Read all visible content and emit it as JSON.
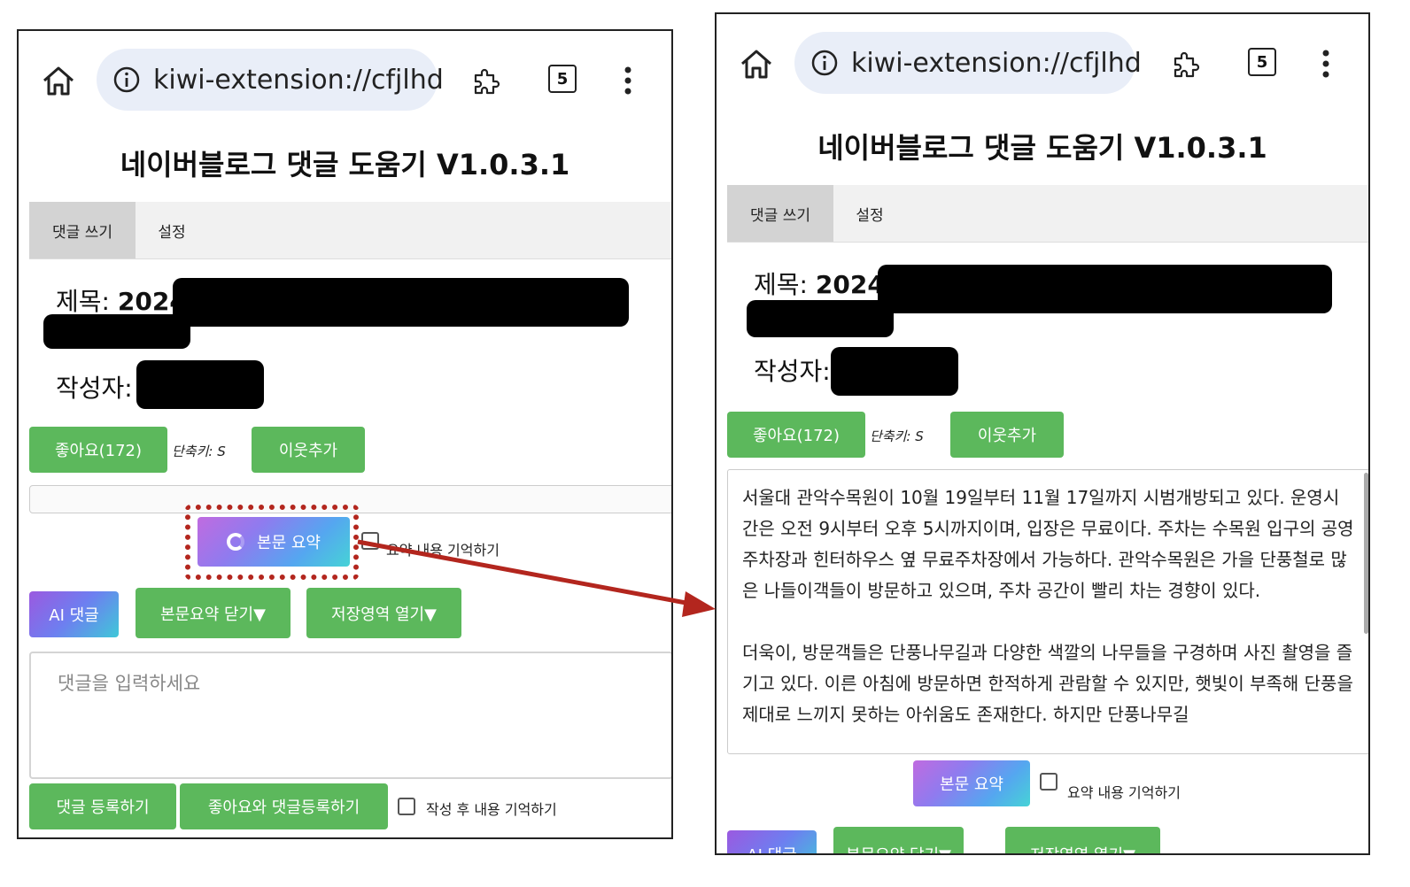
{
  "browser": {
    "url": "kiwi-extension://cfjlhd",
    "tab_count": "5"
  },
  "app": {
    "title": "네이버블로그 댓글 도움기 V1.0.3.1",
    "tabs": [
      "댓글 쓰기",
      "설정"
    ]
  },
  "post": {
    "title_label": "제목:",
    "title_value": "2024",
    "author_label": "작성자:"
  },
  "actions": {
    "like_button": "좋아요(172)",
    "shortcut": "단축키: S",
    "add_neighbor": "이웃추가",
    "summary_button": "본문 요약",
    "remember_summary": "요약 내용 기억하기",
    "ai_comment": "AI 댓글",
    "close_summary": "본문요약 닫기▼",
    "open_storage": "저장영역 열기▼",
    "comment_placeholder": "댓글을  입력하세요",
    "register_comment": "댓글 등록하기",
    "like_and_register": "좋아요와 댓글등록하기",
    "remember_after_write": "작성 후 내용 기억하기"
  },
  "summary_text": {
    "paragraph1": "서울대 관악수목원이 10월 19일부터 11월 17일까지 시범개방되고 있다. 운영시간은 오전 9시부터 오후 5시까지이며, 입장은 무료이다. 주차는 수목원 입구의 공영 주차장과 힌터하우스 옆 무료주차장에서 가능하다. 관악수목원은 가을 단풍철로 많은 나들이객들이 방문하고 있으며, 주차 공간이 빨리 차는 경향이 있다.",
    "paragraph2": "더욱이, 방문객들은 단풍나무길과 다양한 색깔의 나무들을 구경하며 사진 촬영을 즐기고 있다. 이른 아침에 방문하면 한적하게 관람할 수 있지만, 햇빛이 부족해 단풍을 제대로 느끼지 못하는 아쉬움도 존재한다. 하지만 단풍나무길"
  },
  "colors": {
    "green": "#5cb85c",
    "highlight": "#b3261e",
    "urlbar": "#e9eef8"
  }
}
